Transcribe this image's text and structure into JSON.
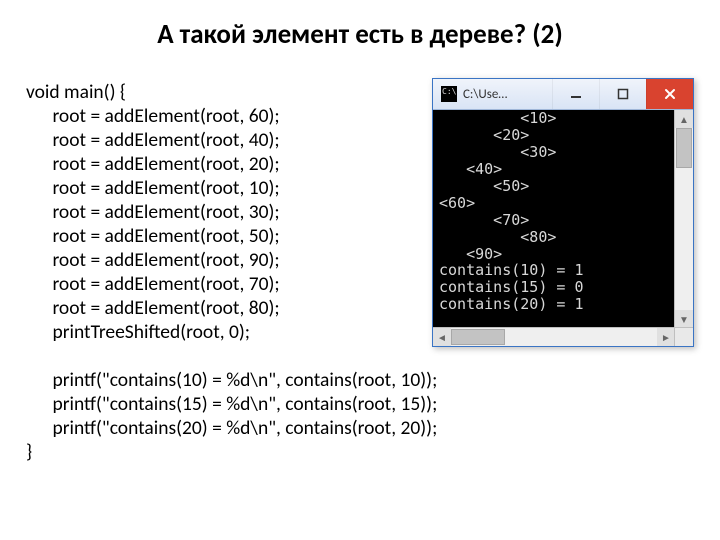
{
  "title": "А такой элемент есть в дереве? (2)",
  "code": "void main() {\n      root = addElement(root, 60);\n      root = addElement(root, 40);\n      root = addElement(root, 20);\n      root = addElement(root, 10);\n      root = addElement(root, 30);\n      root = addElement(root, 50);\n      root = addElement(root, 90);\n      root = addElement(root, 70);\n      root = addElement(root, 80);\n      printTreeShifted(root, 0);\n\n      printf(\"contains(10) = %d\\n\", contains(root, 10));\n      printf(\"contains(15) = %d\\n\", contains(root, 15));\n      printf(\"contains(20) = %d\\n\", contains(root, 20));\n}",
  "console": {
    "window_title": "C:\\Use…",
    "output": "         <10>\n      <20>\n         <30>\n   <40>\n      <50>\n<60>\n      <70>\n         <80>\n   <90>\ncontains(10) = 1\ncontains(15) = 0\ncontains(20) = 1\n_"
  }
}
